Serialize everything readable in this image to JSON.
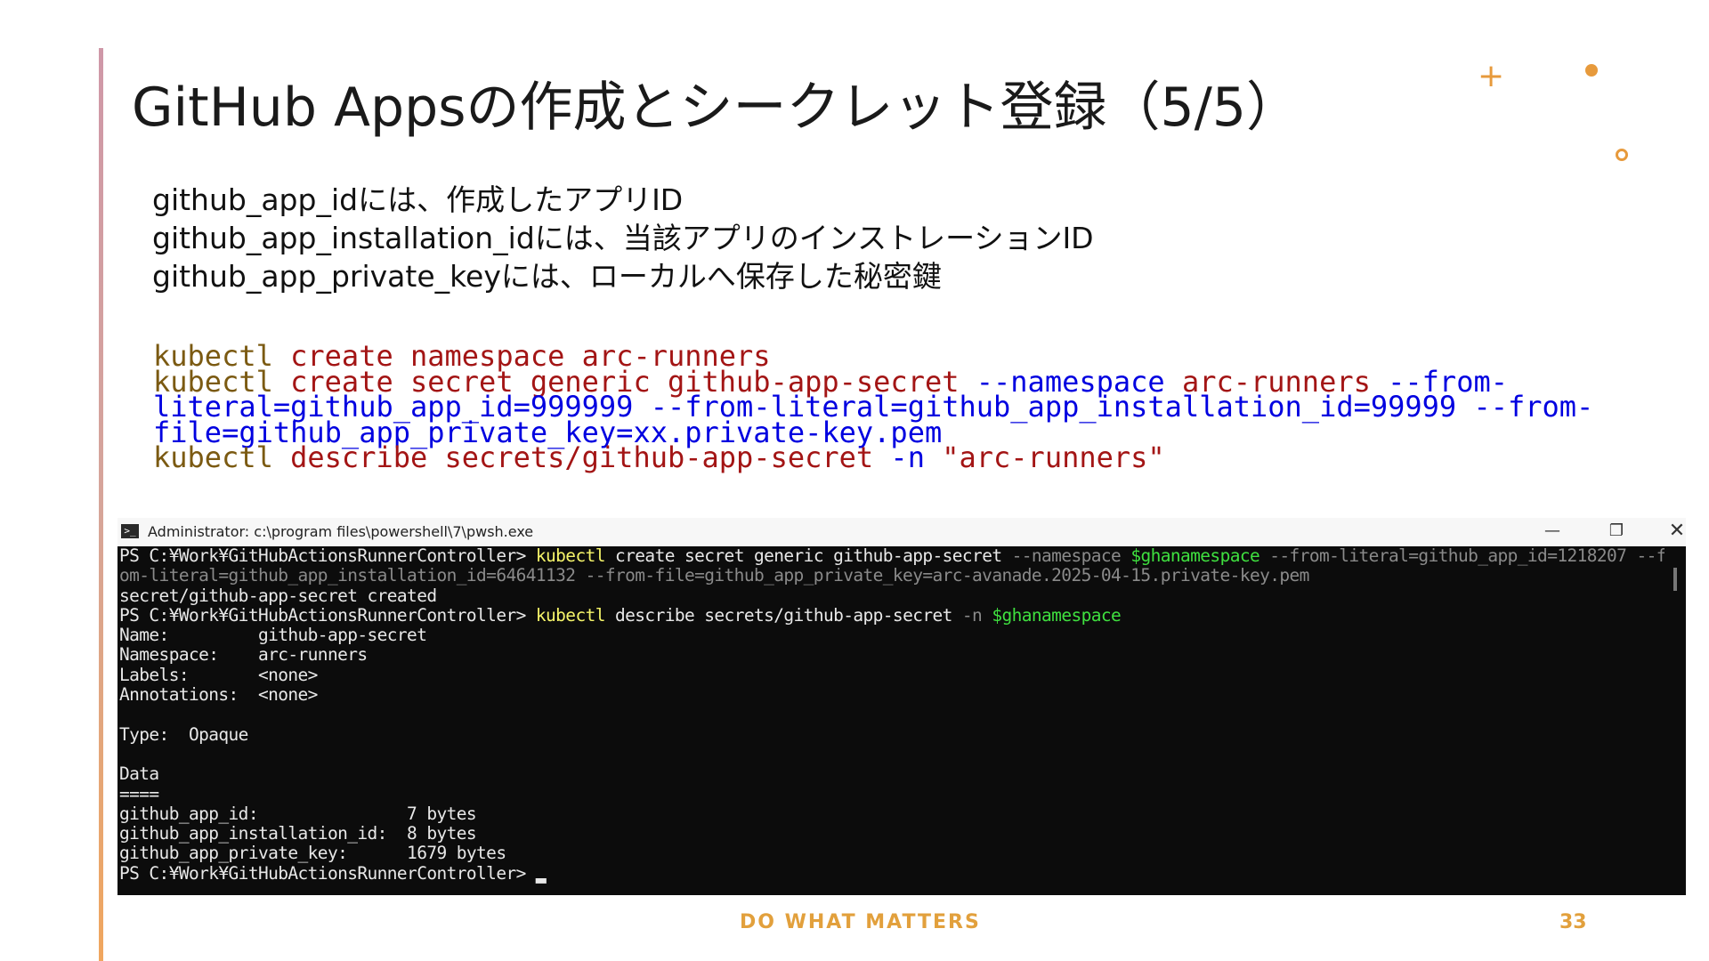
{
  "slide": {
    "title": "GitHub Appsの作成とシークレット登録（5/5）",
    "bullets": [
      "github_app_idには、作成したアプリID",
      "github_app_installation_idには、当該アプリのインストレーションID",
      "github_app_private_keyには、ローカルへ保存した秘密鍵"
    ],
    "code_lines": [
      [
        {
          "t": "kubectl",
          "c": "cmd"
        },
        {
          "t": " create namespace arc-runners",
          "c": "str"
        }
      ],
      [
        {
          "t": "kubectl",
          "c": "cmd"
        },
        {
          "t": " create secret generic github-app-secret ",
          "c": "str"
        },
        {
          "t": "--namespace ",
          "c": "opt"
        },
        {
          "t": "arc-runners ",
          "c": "str"
        },
        {
          "t": "--from-",
          "c": "opt"
        }
      ],
      [
        {
          "t": "literal=github_app_id=999999 --from-literal=github_app_installation_id=99999 --from-",
          "c": "opt"
        }
      ],
      [
        {
          "t": "file=github_app_private_key=xx.private-key.pem",
          "c": "opt"
        }
      ],
      [
        {
          "t": "kubectl",
          "c": "cmd"
        },
        {
          "t": " describe secrets/github-app-secret ",
          "c": "str"
        },
        {
          "t": "-n ",
          "c": "opt"
        },
        {
          "t": "\"arc-runners\"",
          "c": "str"
        }
      ]
    ],
    "footer": "DO WHAT MATTERS",
    "page_number": "33"
  },
  "terminal": {
    "window_title": "Administrator: c:\\program files\\powershell\\7\\pwsh.exe",
    "icon": "powershell-icon",
    "buttons": {
      "minimize": "—",
      "maximize": "❐",
      "close": "✕"
    },
    "lines": [
      [
        {
          "t": "PS C:¥Work¥GitHubActionsRunnerController> ",
          "c": "w"
        },
        {
          "t": "kubectl",
          "c": "yel"
        },
        {
          "t": " create secret generic github-app-secret ",
          "c": "w"
        },
        {
          "t": "--namespace ",
          "c": "gray"
        },
        {
          "t": "$ghanamespace",
          "c": "grn"
        },
        {
          "t": " --from-literal=github_app_id=1218207 --fr",
          "c": "gray"
        }
      ],
      [
        {
          "t": "om-literal=github_app_installation_id=64641132 --from-file=github_app_private_key=arc-avanade.2025-04-15.private-key.pem",
          "c": "gray"
        }
      ],
      [
        {
          "t": "secret/github-app-secret created",
          "c": "w"
        }
      ],
      [
        {
          "t": "PS C:¥Work¥GitHubActionsRunnerController> ",
          "c": "w"
        },
        {
          "t": "kubectl",
          "c": "yel"
        },
        {
          "t": " describe secrets/github-app-secret ",
          "c": "w"
        },
        {
          "t": "-n ",
          "c": "gray"
        },
        {
          "t": "$ghanamespace",
          "c": "grn"
        }
      ],
      [
        {
          "t": "Name:         github-app-secret",
          "c": "w"
        }
      ],
      [
        {
          "t": "Namespace:    arc-runners",
          "c": "w"
        }
      ],
      [
        {
          "t": "Labels:       <none>",
          "c": "w"
        }
      ],
      [
        {
          "t": "Annotations:  <none>",
          "c": "w"
        }
      ],
      [
        {
          "t": "",
          "c": "w"
        }
      ],
      [
        {
          "t": "Type:  Opaque",
          "c": "w"
        }
      ],
      [
        {
          "t": "",
          "c": "w"
        }
      ],
      [
        {
          "t": "Data",
          "c": "w"
        }
      ],
      [
        {
          "t": "====",
          "c": "w"
        }
      ],
      [
        {
          "t": "github_app_id:               7 bytes",
          "c": "w"
        }
      ],
      [
        {
          "t": "github_app_installation_id:  8 bytes",
          "c": "w"
        }
      ],
      [
        {
          "t": "github_app_private_key:      1679 bytes",
          "c": "w"
        }
      ],
      [
        {
          "t": "PS C:¥Work¥GitHubActionsRunnerController> ▂",
          "c": "w"
        }
      ]
    ]
  },
  "colors": {
    "accent": "#e2a03c",
    "code_command": "#7b5a12",
    "code_string": "#a31515",
    "code_option": "#0000e0",
    "terminal_bg": "#0c0c0c"
  }
}
